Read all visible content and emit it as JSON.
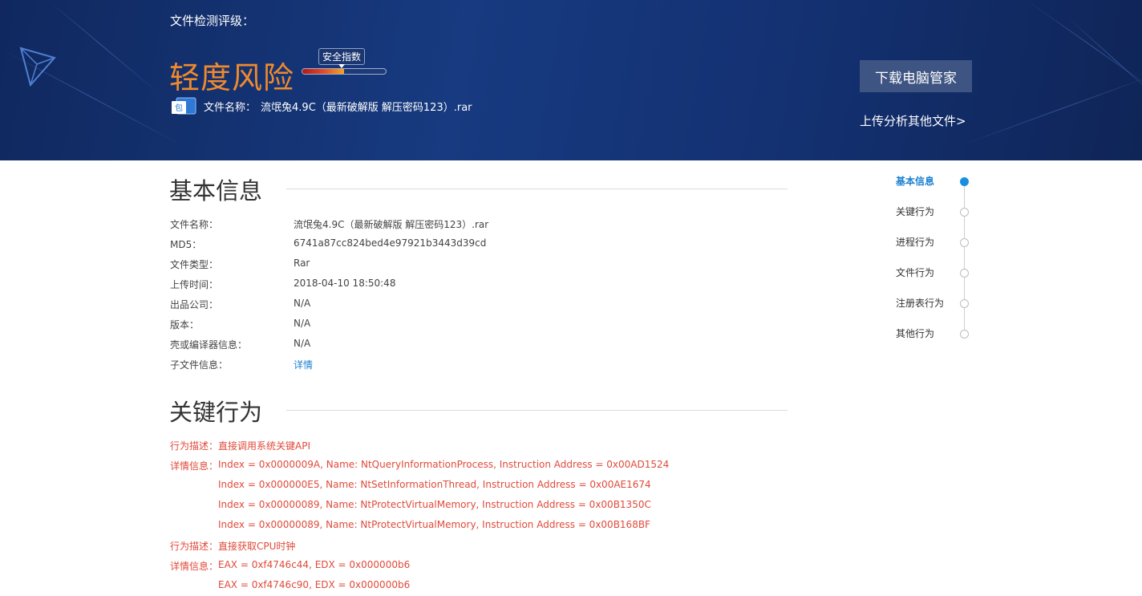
{
  "header": {
    "title": "文件检测评级：",
    "risk_level": "轻度风险",
    "meter": {
      "label": "安全指数",
      "value_percent": 50
    },
    "file_label": "文件名称：",
    "file_name": "流氓兔4.9C（最新破解版 解压密码123）.rar",
    "file_icon_text": "包",
    "download_button": "下载电脑管家",
    "upload_link": "上传分析其他文件>"
  },
  "basic_info": {
    "heading": "基本信息",
    "rows": [
      {
        "key": "文件名称：",
        "value": "流氓兔4.9C（最新破解版 解压密码123）.rar"
      },
      {
        "key": "MD5：",
        "value": "6741a87cc824bed4e97921b3443d39cd"
      },
      {
        "key": "文件类型：",
        "value": "Rar"
      },
      {
        "key": "上传时间：",
        "value": "2018-04-10 18:50:48"
      },
      {
        "key": "出品公司：",
        "value": "N/A"
      },
      {
        "key": "版本：",
        "value": "N/A"
      },
      {
        "key": "壳或编译器信息：",
        "value": "N/A"
      },
      {
        "key": "子文件信息：",
        "value": "详情"
      }
    ]
  },
  "key_behavior": {
    "heading": "关键行为",
    "desc_label": "行为描述：",
    "detail_label": "详情信息：",
    "groups": [
      {
        "description": "直接调用系统关键API",
        "details": [
          "Index = 0x0000009A, Name: NtQueryInformationProcess, Instruction Address = 0x00AD1524",
          "Index = 0x000000E5, Name: NtSetInformationThread, Instruction Address = 0x00AE1674",
          "Index = 0x00000089, Name: NtProtectVirtualMemory, Instruction Address = 0x00B1350C",
          "Index = 0x00000089, Name: NtProtectVirtualMemory, Instruction Address = 0x00B168BF"
        ]
      },
      {
        "description": "直接获取CPU时钟",
        "details": [
          "EAX = 0xf4746c44, EDX = 0x000000b6",
          "EAX = 0xf4746c90, EDX = 0x000000b6"
        ]
      }
    ]
  },
  "side_nav": {
    "items": [
      {
        "label": "基本信息",
        "active": true
      },
      {
        "label": "关键行为",
        "active": false
      },
      {
        "label": "进程行为",
        "active": false
      },
      {
        "label": "文件行为",
        "active": false
      },
      {
        "label": "注册表行为",
        "active": false
      },
      {
        "label": "其他行为",
        "active": false
      }
    ]
  },
  "colors": {
    "header_bg": "#143274",
    "risk_orange": "#f08a2c",
    "accent_blue": "#1a7fd0",
    "behavior_red": "#e04a3a",
    "button_bg": "#3e5482"
  }
}
